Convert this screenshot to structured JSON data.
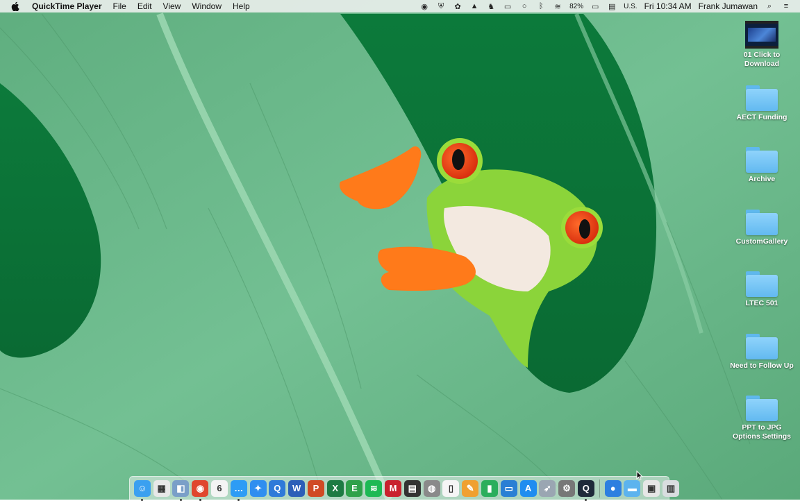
{
  "menubar": {
    "apple_icon": "apple-logo",
    "app_name": "QuickTime Player",
    "menus": [
      "File",
      "Edit",
      "View",
      "Window",
      "Help"
    ],
    "status": {
      "battery_percent": "82%",
      "input_source": "U.S.",
      "clock": "Fri 10:34 AM",
      "user": "Frank Jumawan",
      "icons": [
        "record-icon",
        "shield-icon",
        "color-wheel-icon",
        "drive-icon",
        "bird-icon",
        "airplay-icon",
        "messages-icon",
        "bluetooth-icon",
        "wifi-icon",
        "battery-icon",
        "us-flag-icon",
        "search-icon",
        "list-icon"
      ]
    }
  },
  "desktop_items": [
    {
      "label": "01 Click to Download",
      "line1": "01 Click to",
      "line2": "Download",
      "icon": "movie-file"
    },
    {
      "label": "AECT Funding",
      "line1": "AECT Funding",
      "line2": "",
      "icon": "folder"
    },
    {
      "label": "Archive",
      "line1": "Archive",
      "line2": "",
      "icon": "folder"
    },
    {
      "label": "CustomGallery",
      "line1": "CustomGallery",
      "line2": "",
      "icon": "folder"
    },
    {
      "label": "LTEC 501",
      "line1": "LTEC 501",
      "line2": "",
      "icon": "folder"
    },
    {
      "label": "Need to Follow Up",
      "line1": "Need to Follow Up",
      "line2": "",
      "icon": "folder"
    },
    {
      "label": "PPT to JPG Options Settings",
      "line1": "PPT to JPG",
      "line2": "Options Settings",
      "icon": "folder"
    }
  ],
  "dock": {
    "apps": [
      {
        "name": "finder",
        "glyph": "☺",
        "color": "#3aa0f0",
        "running": true
      },
      {
        "name": "launchpad",
        "glyph": "▦",
        "color": "#e8e8e8",
        "running": false
      },
      {
        "name": "preview",
        "glyph": "◧",
        "color": "#7a9fc8",
        "running": true
      },
      {
        "name": "chrome",
        "glyph": "◉",
        "color": "#e0462f",
        "running": true
      },
      {
        "name": "calendar",
        "glyph": "6",
        "color": "#f4f4f4",
        "running": false
      },
      {
        "name": "messages",
        "glyph": "…",
        "color": "#2d9cf5",
        "running": true
      },
      {
        "name": "safari",
        "glyph": "✦",
        "color": "#2f8ef0",
        "running": false
      },
      {
        "name": "quicktime-q",
        "glyph": "Q",
        "color": "#2e7ad9",
        "running": false
      },
      {
        "name": "word",
        "glyph": "W",
        "color": "#2b5fb8",
        "running": false
      },
      {
        "name": "powerpoint",
        "glyph": "P",
        "color": "#d04a24",
        "running": false
      },
      {
        "name": "excel",
        "glyph": "X",
        "color": "#1d7b43",
        "running": false
      },
      {
        "name": "evernote",
        "glyph": "E",
        "color": "#2fa14a",
        "running": false
      },
      {
        "name": "spotify",
        "glyph": "≋",
        "color": "#1db954",
        "running": false
      },
      {
        "name": "mendeley",
        "glyph": "M",
        "color": "#c9222e",
        "running": false
      },
      {
        "name": "clapper",
        "glyph": "▤",
        "color": "#333333",
        "running": false
      },
      {
        "name": "app-gray",
        "glyph": "◍",
        "color": "#8a8a8a",
        "running": false
      },
      {
        "name": "textedit",
        "glyph": "▯",
        "color": "#f5f5f5",
        "running": false
      },
      {
        "name": "pages",
        "glyph": "✎",
        "color": "#f0a030",
        "running": false
      },
      {
        "name": "numbers",
        "glyph": "▮",
        "color": "#2bae5c",
        "running": false
      },
      {
        "name": "keynote",
        "glyph": "▭",
        "color": "#2a7fd4",
        "running": false
      },
      {
        "name": "app-store",
        "glyph": "A",
        "color": "#1f8df0",
        "running": false
      },
      {
        "name": "rocket",
        "glyph": "➶",
        "color": "#9aa6b2",
        "running": false
      },
      {
        "name": "system-prefs",
        "glyph": "⚙",
        "color": "#777777",
        "running": false
      },
      {
        "name": "quicktime",
        "glyph": "Q",
        "color": "#1f2a3a",
        "running": true
      }
    ],
    "extras": [
      {
        "name": "globe",
        "glyph": "●",
        "color": "#2d7fe0"
      },
      {
        "name": "folder",
        "glyph": "▬",
        "color": "#5cb3ee"
      },
      {
        "name": "downloads",
        "glyph": "▣",
        "color": "#e6e6e6"
      },
      {
        "name": "trash",
        "glyph": "▥",
        "color": "#d9dde0"
      }
    ]
  }
}
